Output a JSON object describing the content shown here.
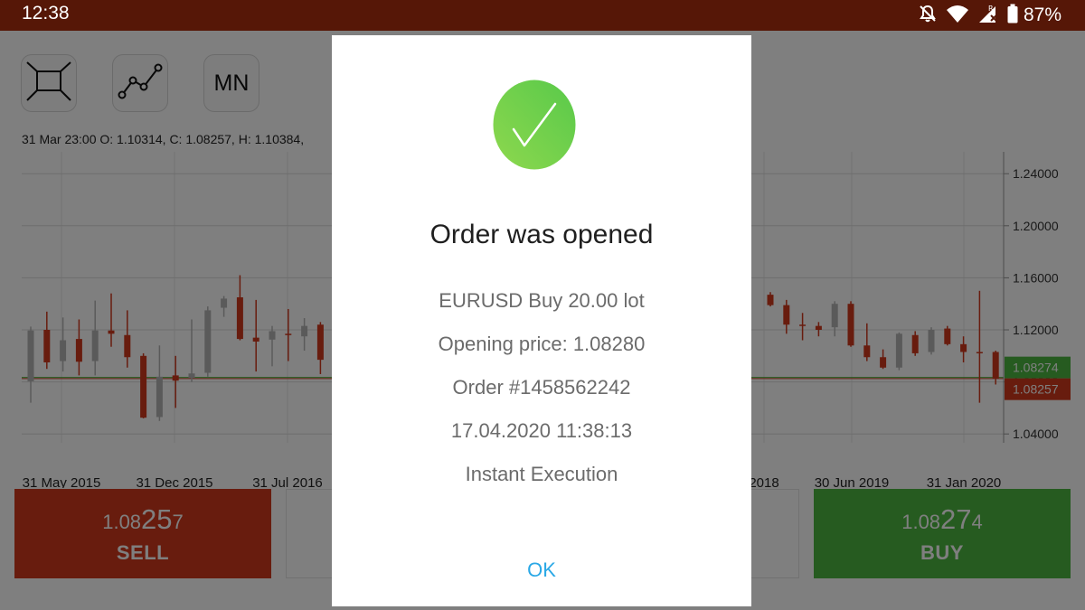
{
  "status_bar": {
    "time": "12:38",
    "battery_percent": "87%",
    "icons": [
      "bell-off-icon",
      "wifi-icon",
      "signal-roaming-icon",
      "battery-icon"
    ]
  },
  "toolbar": {
    "tools": [
      "crosshair-box-icon",
      "line-chart-icon"
    ],
    "timeframe_label": "MN"
  },
  "chart_data": {
    "type": "candlestick",
    "info_line": "31 Mar 23:00 O: 1.10314, C: 1.08257, H: 1.10384,",
    "x_tick_labels": [
      "31 May 2015",
      "31 Dec 2015",
      "31 Jul 2016",
      "2018",
      "30 Jun 2019",
      "31 Jan 2020"
    ],
    "y_tick_labels": [
      "1.24000",
      "1.20000",
      "1.16000",
      "1.12000",
      "1.08000",
      "1.04000"
    ],
    "y_ticks": [
      1.24,
      1.2,
      1.16,
      1.12,
      1.08,
      1.04
    ],
    "ylim": [
      1.0332,
      1.2568
    ],
    "bid_label": "1.08257",
    "ask_label": "1.08274",
    "bid": 1.08257,
    "ask": 1.08274,
    "colors": {
      "up": "#b5b5b5",
      "down": "#d1381d",
      "bid_tag": "#d1381d",
      "ask_tag": "#4cb640"
    },
    "candles_left": [
      {
        "o": 1.0805,
        "c": 1.1195,
        "h": 1.1225,
        "l": 1.064
      },
      {
        "o": 1.12,
        "c": 1.095,
        "h": 1.134,
        "l": 1.09
      },
      {
        "o": 1.096,
        "c": 1.112,
        "h": 1.1295,
        "l": 1.088
      },
      {
        "o": 1.113,
        "c": 1.0955,
        "h": 1.128,
        "l": 1.085
      },
      {
        "o": 1.096,
        "c": 1.1195,
        "h": 1.1425,
        "l": 1.085
      },
      {
        "o": 1.1195,
        "c": 1.117,
        "h": 1.148,
        "l": 1.107
      },
      {
        "o": 1.116,
        "c": 1.099,
        "h": 1.135,
        "l": 1.091
      },
      {
        "o": 1.1,
        "c": 1.0525,
        "h": 1.102,
        "l": 1.052
      },
      {
        "o": 1.053,
        "c": 1.084,
        "h": 1.108,
        "l": 1.05
      },
      {
        "o": 1.085,
        "c": 1.081,
        "h": 1.1,
        "l": 1.06
      },
      {
        "o": 1.083,
        "c": 1.0865,
        "h": 1.128,
        "l": 1.08
      },
      {
        "o": 1.087,
        "c": 1.135,
        "h": 1.138,
        "l": 1.084
      },
      {
        "o": 1.137,
        "c": 1.144,
        "h": 1.146,
        "l": 1.13
      },
      {
        "o": 1.145,
        "c": 1.113,
        "h": 1.162,
        "l": 1.112
      },
      {
        "o": 1.114,
        "c": 1.111,
        "h": 1.143,
        "l": 1.088
      },
      {
        "o": 1.1125,
        "c": 1.119,
        "h": 1.123,
        "l": 1.092
      },
      {
        "o": 1.117,
        "c": 1.1165,
        "h": 1.136,
        "l": 1.096
      },
      {
        "o": 1.115,
        "c": 1.123,
        "h": 1.129,
        "l": 1.104
      },
      {
        "o": 1.124,
        "c": 1.097,
        "h": 1.126,
        "l": 1.086
      }
    ],
    "candles_right": [
      {
        "o": 1.147,
        "c": 1.139,
        "h": 1.149,
        "l": 1.138
      },
      {
        "o": 1.139,
        "c": 1.124,
        "h": 1.143,
        "l": 1.117
      },
      {
        "o": 1.124,
        "c": 1.123,
        "h": 1.133,
        "l": 1.112
      },
      {
        "o": 1.123,
        "c": 1.12,
        "h": 1.126,
        "l": 1.115
      },
      {
        "o": 1.122,
        "c": 1.14,
        "h": 1.142,
        "l": 1.115
      },
      {
        "o": 1.14,
        "c": 1.108,
        "h": 1.142,
        "l": 1.107
      },
      {
        "o": 1.108,
        "c": 1.099,
        "h": 1.125,
        "l": 1.096
      },
      {
        "o": 1.099,
        "c": 1.091,
        "h": 1.105,
        "l": 1.09
      },
      {
        "o": 1.091,
        "c": 1.117,
        "h": 1.118,
        "l": 1.089
      },
      {
        "o": 1.116,
        "c": 1.102,
        "h": 1.119,
        "l": 1.1
      },
      {
        "o": 1.103,
        "c": 1.12,
        "h": 1.122,
        "l": 1.101
      },
      {
        "o": 1.121,
        "c": 1.109,
        "h": 1.123,
        "l": 1.108
      },
      {
        "o": 1.109,
        "c": 1.103,
        "h": 1.115,
        "l": 1.095
      },
      {
        "o": 1.103,
        "c": 1.1025,
        "h": 1.15,
        "l": 1.064
      },
      {
        "o": 1.103,
        "c": 1.0826,
        "h": 1.104,
        "l": 1.078
      }
    ]
  },
  "trade": {
    "sell": {
      "price_prefix": "1.08",
      "price_big": "25",
      "price_suffix": "7",
      "label": "SELL"
    },
    "buy": {
      "price_prefix": "1.08",
      "price_big": "27",
      "price_suffix": "4",
      "label": "BUY"
    }
  },
  "dialog": {
    "icon": "check-circle-icon",
    "title": "Order was opened",
    "lines": [
      "EURUSD Buy 20.00 lot",
      "Opening price: 1.08280",
      "Order #1458562242",
      "17.04.2020 11:38:13",
      "Instant Execution"
    ],
    "ok_label": "OK",
    "check_colors": [
      "#8ed84e",
      "#58c94a"
    ]
  }
}
